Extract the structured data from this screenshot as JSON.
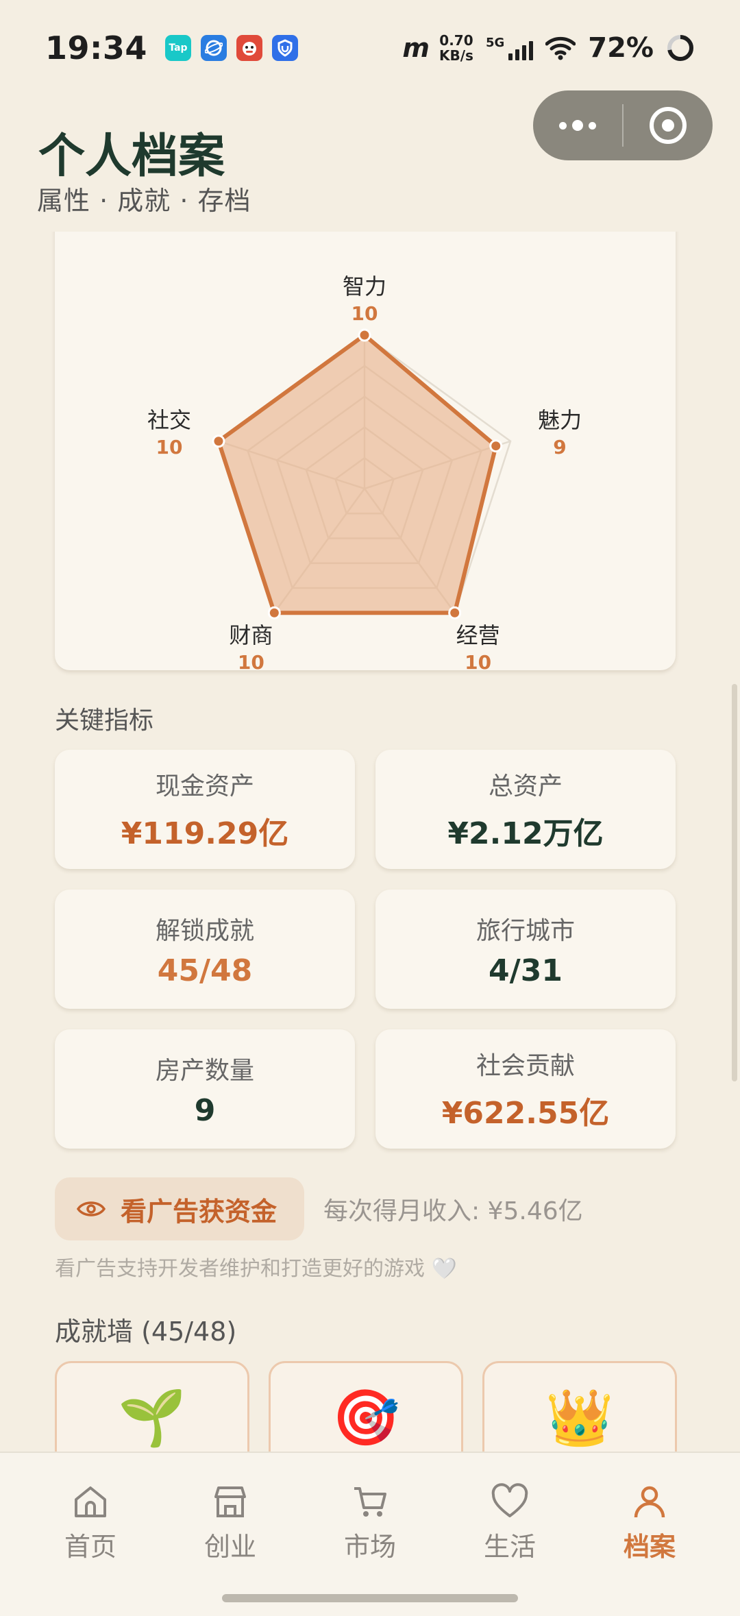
{
  "status_bar": {
    "time": "19:34",
    "apps": [
      {
        "icon": "taptap-icon",
        "text": "Tap",
        "color": "#19c8c8"
      },
      {
        "icon": "browser-icon",
        "text": "",
        "color": "#2a7de1"
      },
      {
        "icon": "mascot-app-icon",
        "text": "",
        "color": "#e04a3a"
      },
      {
        "icon": "shield-app-icon",
        "text": "",
        "color": "#2f6fe8"
      }
    ],
    "speed_value": "0.70",
    "speed_unit": "KB/s",
    "network": "5G",
    "battery": "72%"
  },
  "header": {
    "title": "个人档案",
    "subtitle": "属性 · 成就 · 存档"
  },
  "radar": {
    "axes": [
      {
        "name": "智力",
        "value": "10"
      },
      {
        "name": "魅力",
        "value": "9"
      },
      {
        "name": "经营",
        "value": "10"
      },
      {
        "name": "财商",
        "value": "10"
      },
      {
        "name": "社交",
        "value": "10"
      }
    ],
    "max": 10,
    "colors": {
      "fill": "#e8b08a",
      "stroke": "#d1773e"
    }
  },
  "key_metrics": {
    "title": "关键指标",
    "items": [
      {
        "label": "现金资产",
        "value": "¥119.29亿",
        "color": "#c4622b"
      },
      {
        "label": "总资产",
        "value": "¥2.12万亿",
        "color": "#1f3a2e"
      },
      {
        "label": "解锁成就",
        "value": "45/48",
        "color": "#d1773e"
      },
      {
        "label": "旅行城市",
        "value": "4/31",
        "color": "#1f3a2e"
      },
      {
        "label": "房产数量",
        "value": "9",
        "color": "#1f3a2e"
      },
      {
        "label": "社会贡献",
        "value": "¥622.55亿",
        "color": "#c4622b"
      }
    ]
  },
  "ad": {
    "button_label": "看广告获资金",
    "income": "每次得月收入: ¥5.46亿",
    "note": "看广告支持开发者维护和打造更好的游戏 🤍"
  },
  "achievements": {
    "title": "成就墙 (45/48)",
    "items": [
      {
        "emoji": "🌱"
      },
      {
        "emoji": "🎯"
      },
      {
        "emoji": "👑"
      }
    ]
  },
  "nav": {
    "items": [
      {
        "label": "首页",
        "icon": "home-icon",
        "active": false
      },
      {
        "label": "创业",
        "icon": "shop-icon",
        "active": false
      },
      {
        "label": "市场",
        "icon": "cart-icon",
        "active": false
      },
      {
        "label": "生活",
        "icon": "heart-icon",
        "active": false
      },
      {
        "label": "档案",
        "icon": "person-icon",
        "active": true
      }
    ]
  }
}
